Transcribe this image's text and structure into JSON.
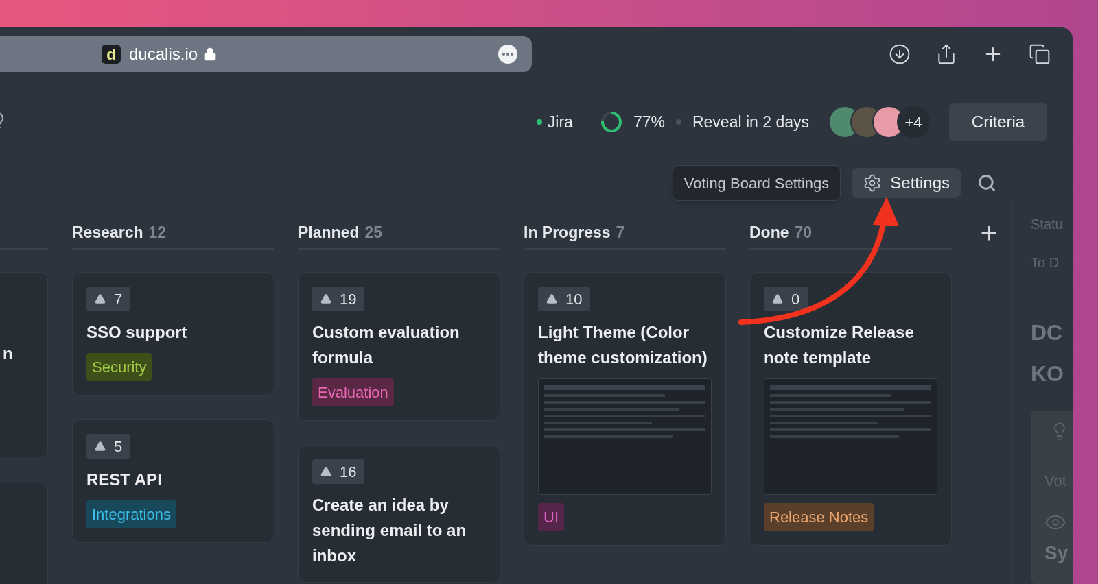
{
  "browser": {
    "site_letter": "d",
    "url": "ducalis.io"
  },
  "header": {
    "integration": "Jira",
    "progress": {
      "level": 0.77,
      "reading": "77%"
    },
    "reveal": "Reveal in 2 days",
    "more_members": "+4",
    "criteria_button": "Criteria"
  },
  "toolbar": {
    "tooltip": "Voting Board Settings",
    "settings_button": "Settings"
  },
  "partial_column": {
    "card_text": "n"
  },
  "columns": [
    {
      "title": "Research",
      "count": "12",
      "cards": [
        {
          "votes": "7",
          "title": "SSO support",
          "screenshot": false,
          "tags": [
            {
              "label": "Security",
              "color": "#3e4f1a"
            }
          ]
        },
        {
          "votes": "5",
          "title": "REST API",
          "screenshot": false,
          "tags": [
            {
              "label": "Integrations",
              "color": "#17495a"
            }
          ]
        }
      ]
    },
    {
      "title": "Planned",
      "count": "25",
      "cards": [
        {
          "votes": "19",
          "title": "Custom evaluation formula",
          "screenshot": false,
          "tags": [
            {
              "label": "Evaluation",
              "color": "#5a2845"
            }
          ]
        },
        {
          "votes": "16",
          "title": "Create an idea by sending email to an inbox",
          "screenshot": false
        }
      ]
    },
    {
      "title": "In Progress",
      "count": "7",
      "cards": [
        {
          "votes": "10",
          "title": "Light Theme (Color theme customization)",
          "screenshot": true,
          "tags": [
            {
              "label": "UI",
              "color": "#55254a"
            }
          ]
        }
      ]
    },
    {
      "title": "Done",
      "count": "70",
      "cards": [
        {
          "votes": "0",
          "title": "Customize Release note template",
          "screenshot": true,
          "tags": [
            {
              "label": "Release Notes",
              "color": "#5a3f2a"
            }
          ]
        }
      ]
    }
  ],
  "side_panel": {
    "status_label": "Statu",
    "status_value": "To D",
    "heading_lines": [
      "DC",
      "KO"
    ],
    "vote_label": "Vot",
    "section_title": "Sy"
  }
}
